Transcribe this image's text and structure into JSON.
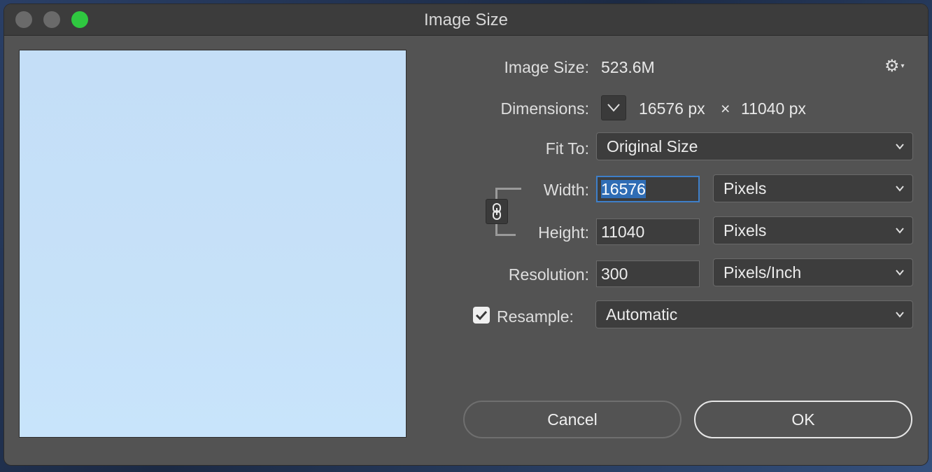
{
  "window": {
    "title": "Image Size"
  },
  "image_size": {
    "label": "Image Size:",
    "value": "523.6M"
  },
  "settings": {
    "icon": "gear-icon"
  },
  "dimensions": {
    "label": "Dimensions:",
    "width": "16576 px",
    "times": "×",
    "height": "11040 px"
  },
  "fit_to": {
    "label": "Fit To:",
    "selected": "Original Size"
  },
  "width": {
    "label": "Width:",
    "value": "16576",
    "unit": "Pixels"
  },
  "height": {
    "label": "Height:",
    "value": "11040",
    "unit": "Pixels"
  },
  "resolution": {
    "label": "Resolution:",
    "value": "300",
    "unit": "Pixels/Inch"
  },
  "resample": {
    "label": "Resample:",
    "checked": true,
    "selected": "Automatic"
  },
  "buttons": {
    "cancel": "Cancel",
    "ok": "OK"
  },
  "colors": {
    "window_bg": "#535353",
    "titlebar_bg": "#3c3c3c",
    "focus_accent": "#3e7fc9",
    "zoom_green": "#2fc840",
    "preview_blue": "#c6e1f8"
  }
}
